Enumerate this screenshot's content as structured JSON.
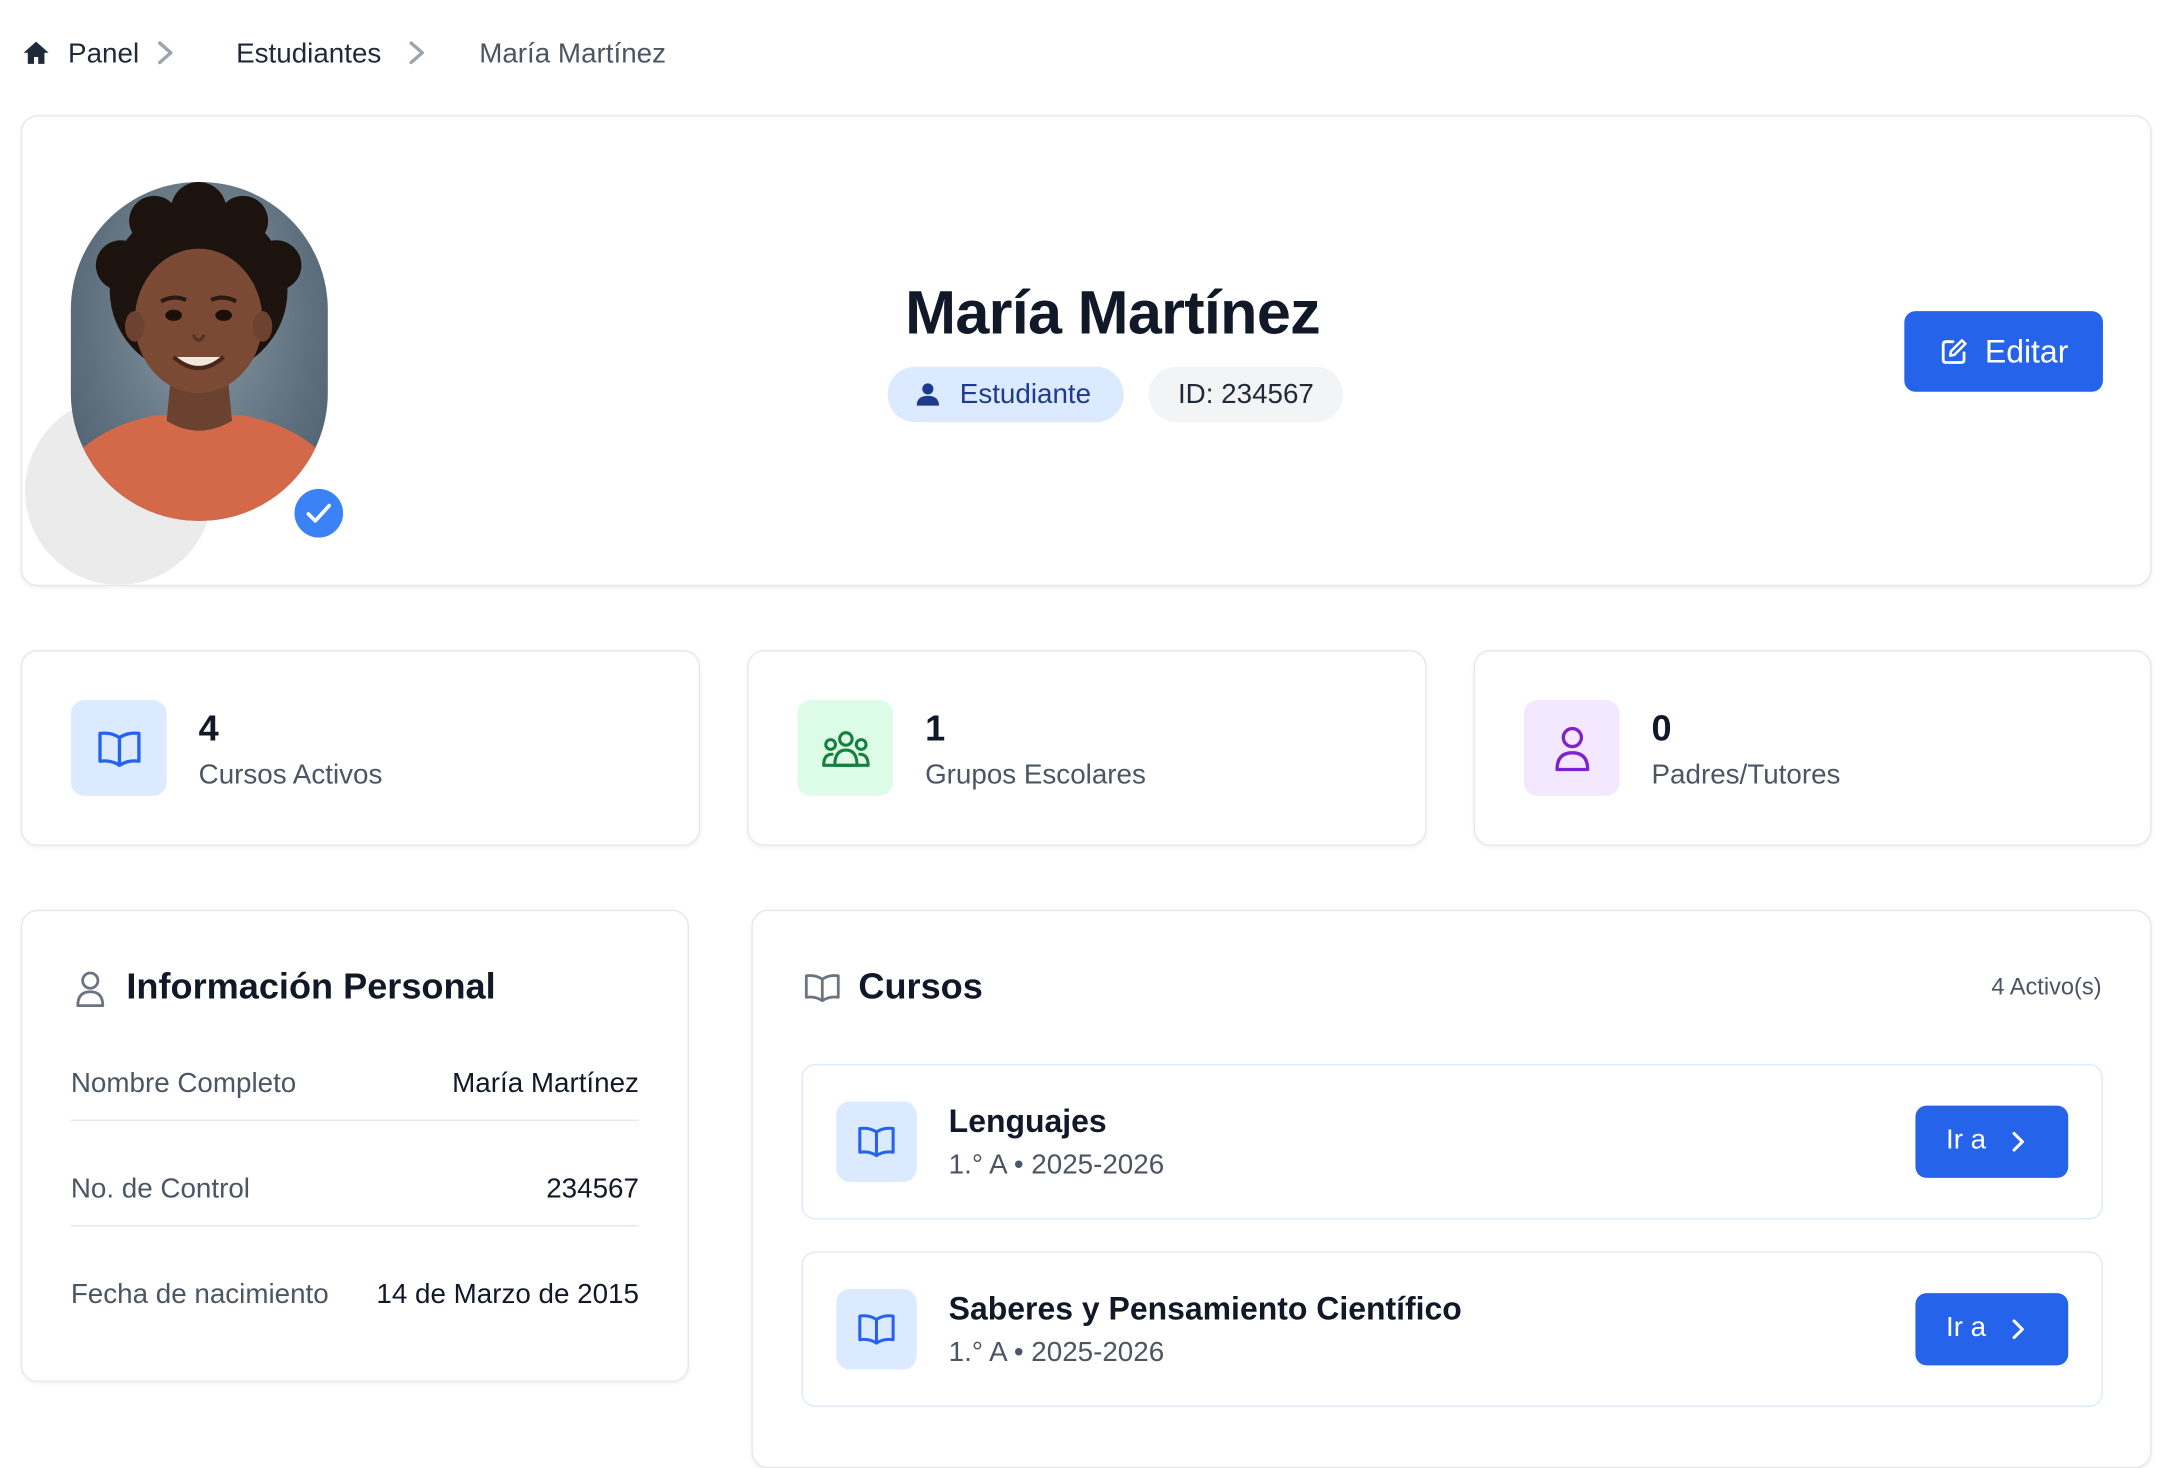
{
  "breadcrumb": {
    "home": "Panel",
    "students": "Estudiantes",
    "current": "María Martínez"
  },
  "profile": {
    "name": "María Martínez",
    "role": "Estudiante",
    "id_badge": "ID: 234567",
    "edit_label": "Editar"
  },
  "stats": [
    {
      "value": "4",
      "label": "Cursos Activos",
      "icon": "book-open-icon",
      "color": "#2563eb",
      "bg": "#dbeafe"
    },
    {
      "value": "1",
      "label": "Grupos Escolares",
      "icon": "users-group-icon",
      "color": "#15803d",
      "bg": "#dcfce7"
    },
    {
      "value": "0",
      "label": "Padres/Tutores",
      "icon": "user-icon",
      "color": "#7e22ce",
      "bg": "#f3e8ff"
    }
  ],
  "personal": {
    "title": "Información Personal",
    "rows": [
      {
        "label": "Nombre Completo",
        "value": "María Martínez"
      },
      {
        "label": "No. de Control",
        "value": "234567"
      },
      {
        "label": "Fecha de nacimiento",
        "value": "14 de Marzo de 2015"
      }
    ]
  },
  "courses": {
    "title": "Cursos",
    "count": "4 Activo(s)",
    "items": [
      {
        "title": "Lenguajes",
        "sub": "1.° A • 2025-2026",
        "go": "Ir a"
      },
      {
        "title": "Saberes y Pensamiento Científico",
        "sub": "1.° A • 2025-2026",
        "go": "Ir a"
      }
    ]
  },
  "colors": {
    "primary": "#2563eb",
    "verified": "#3b82f6",
    "role_badge_bg": "#dbeafe"
  }
}
